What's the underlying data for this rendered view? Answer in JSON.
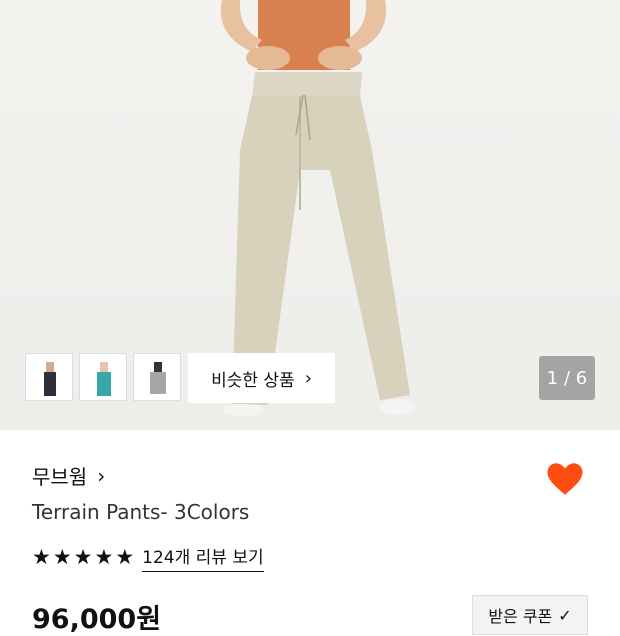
{
  "hero": {
    "image_alt": "Model wearing beige wide pants"
  },
  "thumbnails": [
    "thumb-black",
    "thumb-teal",
    "thumb-gray"
  ],
  "similar_button": {
    "label": "비슷한 상품",
    "icon": "chevron-right-icon"
  },
  "counter": {
    "text": "1 / 6"
  },
  "brand": {
    "name": "무브웜",
    "icon": "chevron-right-icon"
  },
  "wishlist": {
    "icon": "heart-icon",
    "color": "#ff4d12"
  },
  "product": {
    "title": "Terrain Pants- 3Colors"
  },
  "rating": {
    "stars": 5,
    "reviews_label": "124개 리뷰 보기"
  },
  "price": {
    "text": "96,000원"
  },
  "coupon": {
    "label": "받은 쿠폰",
    "icon": "check-icon"
  }
}
